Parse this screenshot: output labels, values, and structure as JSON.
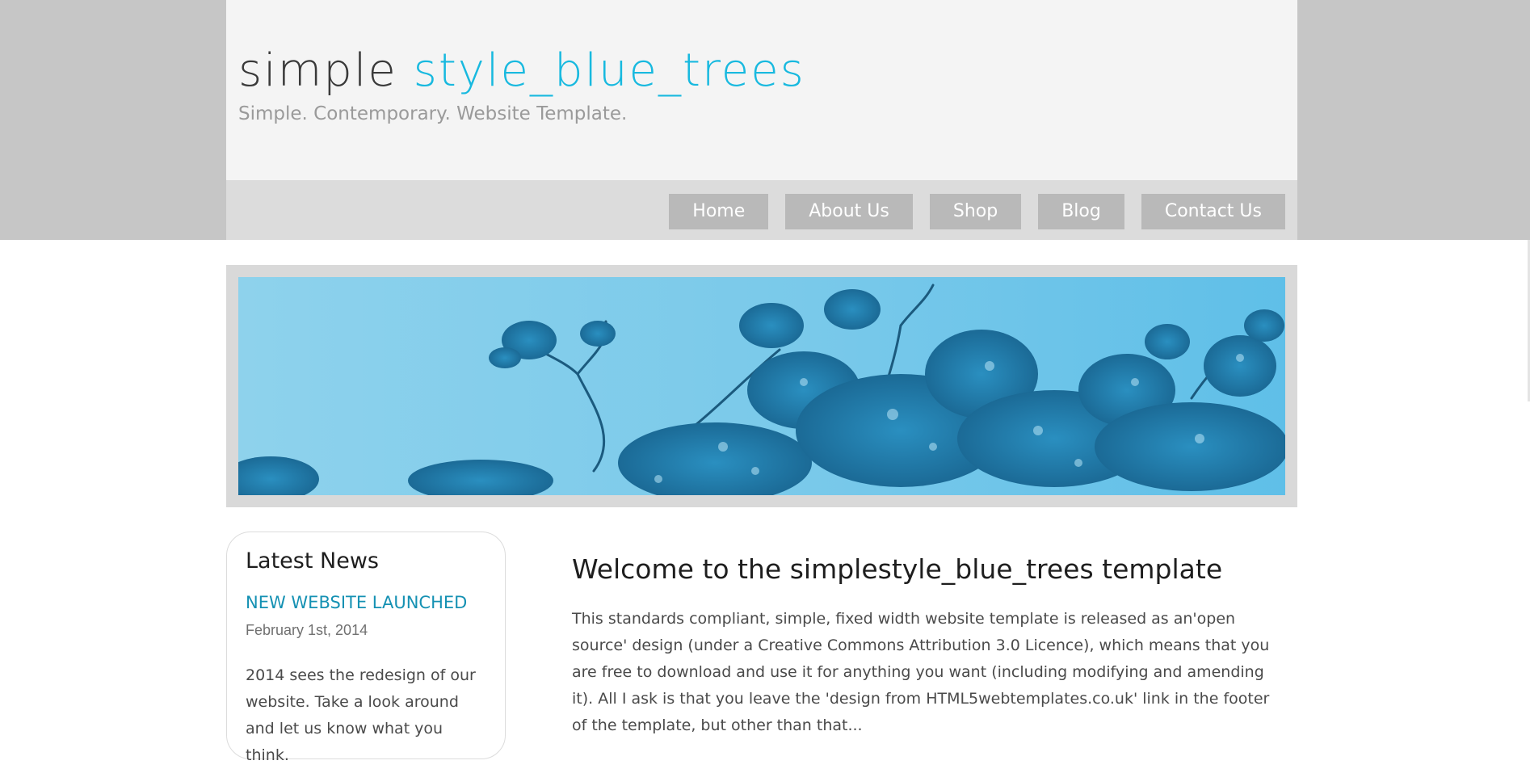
{
  "header": {
    "logo_part1": "simple ",
    "logo_part2": "style_blue_trees",
    "slogan": "Simple. Contemporary. Website Template."
  },
  "menu": {
    "items": [
      {
        "label": "Home"
      },
      {
        "label": "About Us"
      },
      {
        "label": "Shop"
      },
      {
        "label": "Blog"
      },
      {
        "label": "Contact Us"
      }
    ]
  },
  "sidebar": {
    "heading": "Latest News",
    "news_title": "NEW WEBSITE LAUNCHED",
    "news_date": "February 1st, 2014",
    "news_body": "2014 sees the redesign of our website. Take a look around and let us know what you think."
  },
  "content": {
    "heading": "Welcome to the simplestyle_blue_trees template",
    "paragraph": "This standards compliant, simple, fixed width website template is released as an'open source' design (under a Creative Commons Attribution 3.0 Licence), which means that you are free to download and use it for anything you want (including modifying and amending it). All I ask is that you leave the 'design from HTML5webtemplates.co.uk' link in the footer of the template, but other than that..."
  },
  "colors": {
    "accent": "#18b9df",
    "link": "#1591b3",
    "top_band": "#c6c6c6",
    "header_bg": "#f4f4f4",
    "menubar_bg": "#dcdcdc",
    "menu_button": "#b9b9b9"
  },
  "banner": {
    "icon": "blue-trees-banner-image"
  }
}
